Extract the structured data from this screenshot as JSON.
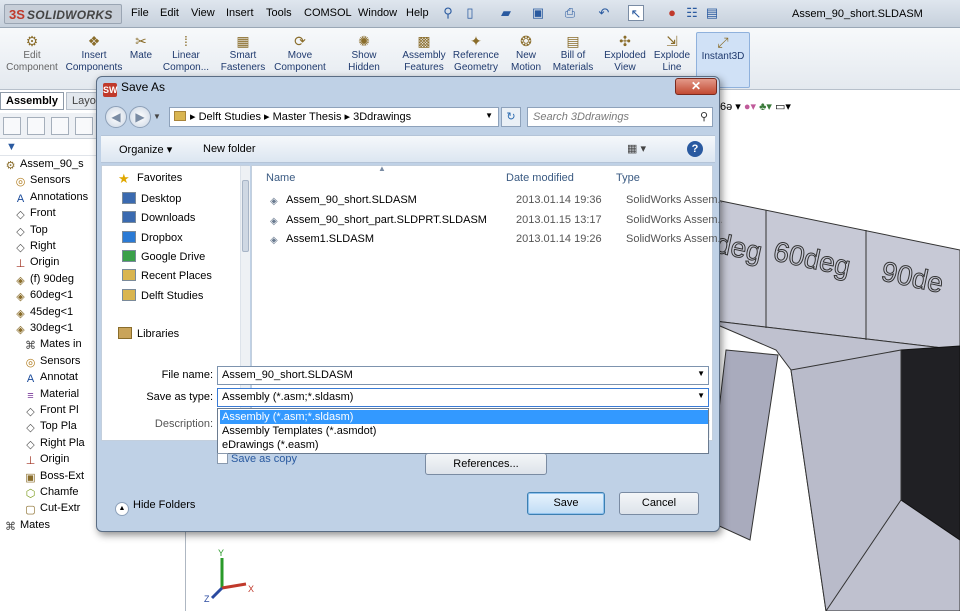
{
  "app": {
    "logo_text": "SOLIDWORKS",
    "menus": [
      "File",
      "Edit",
      "View",
      "Insert",
      "Tools",
      "COMSOL",
      "Window",
      "Help"
    ],
    "document_title": "Assem_90_short.SLDASM"
  },
  "ribbon": {
    "edit_component": "Edit Component",
    "insert_components": "Insert Components",
    "mate": "Mate",
    "linear": "Linear Compon...",
    "smart": "Smart Fasteners",
    "move": "Move Component",
    "show_hidden": "Show Hidden",
    "assembly_features": "Assembly Features",
    "reference_geometry": "Reference Geometry",
    "new_motion": "New Motion",
    "bill_of_materials": "Bill of Materials",
    "exploded_view": "Exploded View",
    "explode_line": "Explode Line",
    "instant3d": "Instant3D"
  },
  "feature_tree": {
    "tabs": [
      "Assembly",
      "Layout"
    ],
    "items": [
      {
        "label": "Assem_90_s",
        "indent": 0,
        "icon": "assembly-icon"
      },
      {
        "label": "Sensors",
        "indent": 1,
        "icon": "sensor-icon"
      },
      {
        "label": "Annotations",
        "indent": 1,
        "icon": "annotation-icon"
      },
      {
        "label": "Front",
        "indent": 1,
        "icon": "plane-icon"
      },
      {
        "label": "Top",
        "indent": 1,
        "icon": "plane-icon"
      },
      {
        "label": "Right",
        "indent": 1,
        "icon": "plane-icon"
      },
      {
        "label": "Origin",
        "indent": 1,
        "icon": "origin-icon"
      },
      {
        "label": "(f) 90deg",
        "indent": 1,
        "icon": "part-icon"
      },
      {
        "label": "60deg<1",
        "indent": 1,
        "icon": "part-icon"
      },
      {
        "label": "45deg<1",
        "indent": 1,
        "icon": "part-icon"
      },
      {
        "label": "30deg<1",
        "indent": 1,
        "icon": "part-icon"
      },
      {
        "label": "Mates in",
        "indent": 2,
        "icon": "mates-icon"
      },
      {
        "label": "Sensors",
        "indent": 2,
        "icon": "sensor-icon"
      },
      {
        "label": "Annotat",
        "indent": 2,
        "icon": "annotation-icon"
      },
      {
        "label": "Material",
        "indent": 2,
        "icon": "material-icon"
      },
      {
        "label": "Front Pl",
        "indent": 2,
        "icon": "plane-icon"
      },
      {
        "label": "Top Pla",
        "indent": 2,
        "icon": "plane-icon"
      },
      {
        "label": "Right Pla",
        "indent": 2,
        "icon": "plane-icon"
      },
      {
        "label": "Origin",
        "indent": 2,
        "icon": "origin-icon"
      },
      {
        "label": "Boss-Ext",
        "indent": 2,
        "icon": "boss-icon"
      },
      {
        "label": "Chamfe",
        "indent": 2,
        "icon": "chamfer-icon"
      },
      {
        "label": "Cut-Extr",
        "indent": 2,
        "icon": "cut-icon"
      },
      {
        "label": "Mates",
        "indent": 0,
        "icon": "mates-icon"
      }
    ]
  },
  "viewport": {
    "part_labels": [
      "deg",
      "60deg",
      "90de"
    ],
    "triad_labels": [
      "Y",
      "Z",
      "X"
    ]
  },
  "dialog": {
    "title": "Save As",
    "close": "✕",
    "address": "▸ Delft Studies ▸ Master Thesis ▸ 3Ddrawings",
    "search_placeholder": "Search 3Ddrawings",
    "organize": "Organize ▾",
    "new_folder": "New folder",
    "help": "?",
    "nav": {
      "favorites_label": "Favorites",
      "favorites": [
        "Desktop",
        "Downloads",
        "Dropbox",
        "Google Drive",
        "Recent Places",
        "Delft Studies"
      ],
      "libraries": "Libraries"
    },
    "columns": {
      "name": "Name",
      "date": "Date modified",
      "type": "Type"
    },
    "files": [
      {
        "name": "Assem_90_short.SLDASM",
        "date": "2013.01.14 19:36",
        "type": "SolidWorks Assem..."
      },
      {
        "name": "Assem_90_short_part.SLDPRT.SLDASM",
        "date": "2013.01.15 13:17",
        "type": "SolidWorks Assem..."
      },
      {
        "name": "Assem1.SLDASM",
        "date": "2013.01.14 19:26",
        "type": "SolidWorks Assem..."
      }
    ],
    "file_name_label": "File name:",
    "file_name_value": "Assem_90_short.SLDASM",
    "save_type_label": "Save as type:",
    "save_type_value": "Assembly (*.asm;*.sldasm)",
    "type_options": [
      "Assembly (*.asm;*.sldasm)",
      "Assembly Templates (*.asmdot)",
      "eDrawings (*.easm)"
    ],
    "description_label": "Description:",
    "save_as_copy": "Save as copy",
    "references": "References...",
    "hide_folders": "Hide Folders",
    "save": "Save",
    "cancel": "Cancel"
  },
  "colors": {
    "accent": "#3399ff",
    "dialog_frame": "#bfd1e6",
    "close_button": "#c24a32"
  }
}
